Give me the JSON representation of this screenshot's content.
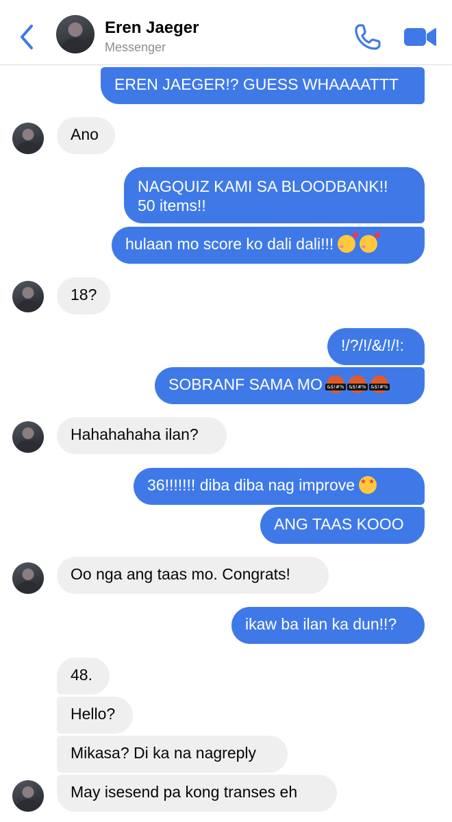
{
  "header": {
    "contact_name": "Eren Jaeger",
    "subtitle": "Messenger",
    "accent_color": "#3f79e8",
    "icons": [
      "back-chevron-icon",
      "phone-icon",
      "video-call-icon"
    ]
  },
  "messages": [
    {
      "sender": "me",
      "text": "EREN JAEGER!? GUESS WHAAAATTT"
    },
    {
      "sender": "contact",
      "text": "Ano"
    },
    {
      "sender": "me",
      "text": "NAGQUIZ KAMI SA BLOODBANK!!",
      "text2": "50 items!!"
    },
    {
      "sender": "me",
      "text": "hulaan mo score ko dali dali!!!",
      "emoji": "smiling-face-with-hearts x2"
    },
    {
      "sender": "contact",
      "text": "18?"
    },
    {
      "sender": "me",
      "text": "!/?/!/&/!/!:"
    },
    {
      "sender": "me",
      "text": "SOBRANF SAMA MO",
      "emoji": "face-with-symbols-on-mouth x3"
    },
    {
      "sender": "contact",
      "text": "Hahahahaha ilan?"
    },
    {
      "sender": "me",
      "text": "36!!!!!!! diba diba nag improve",
      "emoji": "star-struck"
    },
    {
      "sender": "me",
      "text": "ANG TAAS KOOO"
    },
    {
      "sender": "contact",
      "text": "Oo nga ang taas mo. Congrats!"
    },
    {
      "sender": "me",
      "text": "ikaw ba ilan ka dun!!?"
    },
    {
      "sender": "contact",
      "text": "48."
    },
    {
      "sender": "contact",
      "text": "Hello?"
    },
    {
      "sender": "contact",
      "text": "Mikasa? Di ka na nagreply"
    },
    {
      "sender": "contact",
      "text": "May isesend pa kong transes eh"
    }
  ]
}
